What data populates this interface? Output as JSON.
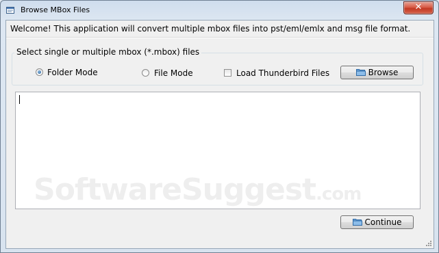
{
  "window": {
    "title": "Browse MBox Files",
    "close_glyph": "✕"
  },
  "welcome_text": "Welcome! This application will convert multiple mbox files into pst/eml/emlx and msg file format.",
  "group": {
    "label": "Select single or multiple mbox (*.mbox) files",
    "options": [
      {
        "label": "Folder Mode",
        "type": "radio",
        "checked": true
      },
      {
        "label": "File Mode",
        "type": "radio",
        "checked": false
      },
      {
        "label": "Load Thunderbird Files",
        "type": "checkbox",
        "checked": false
      }
    ],
    "browse_label": "Browse"
  },
  "file_list": {
    "items": []
  },
  "continue_label": "Continue",
  "watermark": {
    "main": "SoftwareSuggest",
    "tld": ".com"
  },
  "icons": {
    "app": "app-window-icon",
    "browse": "folder-icon",
    "continue": "folder-icon"
  }
}
